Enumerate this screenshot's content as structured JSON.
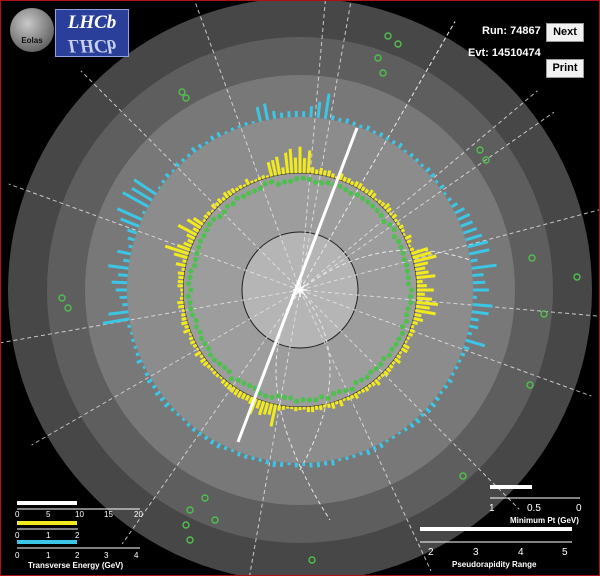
{
  "header": {
    "run_label": "Run: 74867",
    "evt_label": "Evt: 14510474",
    "next_button": "Next",
    "print_button": "Print"
  },
  "logos": {
    "eolas": "Eolas",
    "lhcb": "LHCb"
  },
  "energy_scale": {
    "title": "Transverse Energy (GeV)",
    "white_ticks": [
      "0",
      "5",
      "10",
      "15",
      "20"
    ],
    "yellow_ticks": [
      "0",
      "1",
      "2"
    ],
    "cyan_ticks": [
      "0",
      "1",
      "2",
      "3",
      "4"
    ],
    "cyan_ticks_bottom": [
      "0",
      "1",
      "2",
      "3",
      "4"
    ]
  },
  "pt_scale": {
    "title": "Minimum Pt (GeV)",
    "ticks": [
      "1",
      "0.5",
      "0"
    ]
  },
  "eta_scale": {
    "title": "Pseudorapidity Range",
    "ticks": [
      "2",
      "3",
      "4",
      "5"
    ]
  },
  "colors": {
    "background": "#000000",
    "frame": "#b01010",
    "track": "#ffffff",
    "yellow_deposit": "#f2ea1d",
    "cyan_deposit": "#3cc6e6",
    "green_hit": "#4fbf4f"
  }
}
